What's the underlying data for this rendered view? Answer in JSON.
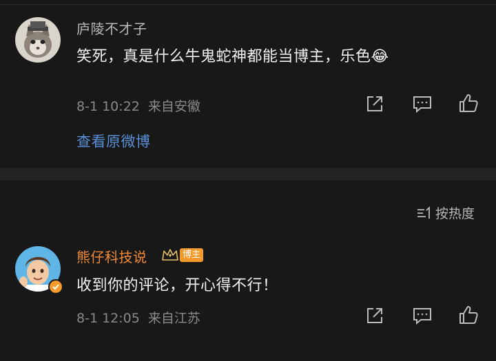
{
  "comment1": {
    "username": "庐陵不才子",
    "text": "笑死，真是什么牛鬼蛇神都能当博主，乐色",
    "emoji": "😂",
    "time": "8-1 10:22",
    "location": "来自安徽"
  },
  "view_original_label": "查看原微博",
  "sort_label": "按热度",
  "comment2": {
    "username": "熊仔科技说",
    "badge": "博主",
    "text": "收到你的评论，开心得不行！",
    "time": "8-1 12:05",
    "location": "来自江苏"
  },
  "colors": {
    "background": "#181818",
    "link": "#5a8fd6",
    "blogger_name": "#f08a36",
    "meta": "#8a8a8a"
  },
  "icons": [
    "share-icon",
    "comment-icon",
    "like-icon",
    "sort-icon",
    "crown-icon",
    "verified-icon"
  ]
}
